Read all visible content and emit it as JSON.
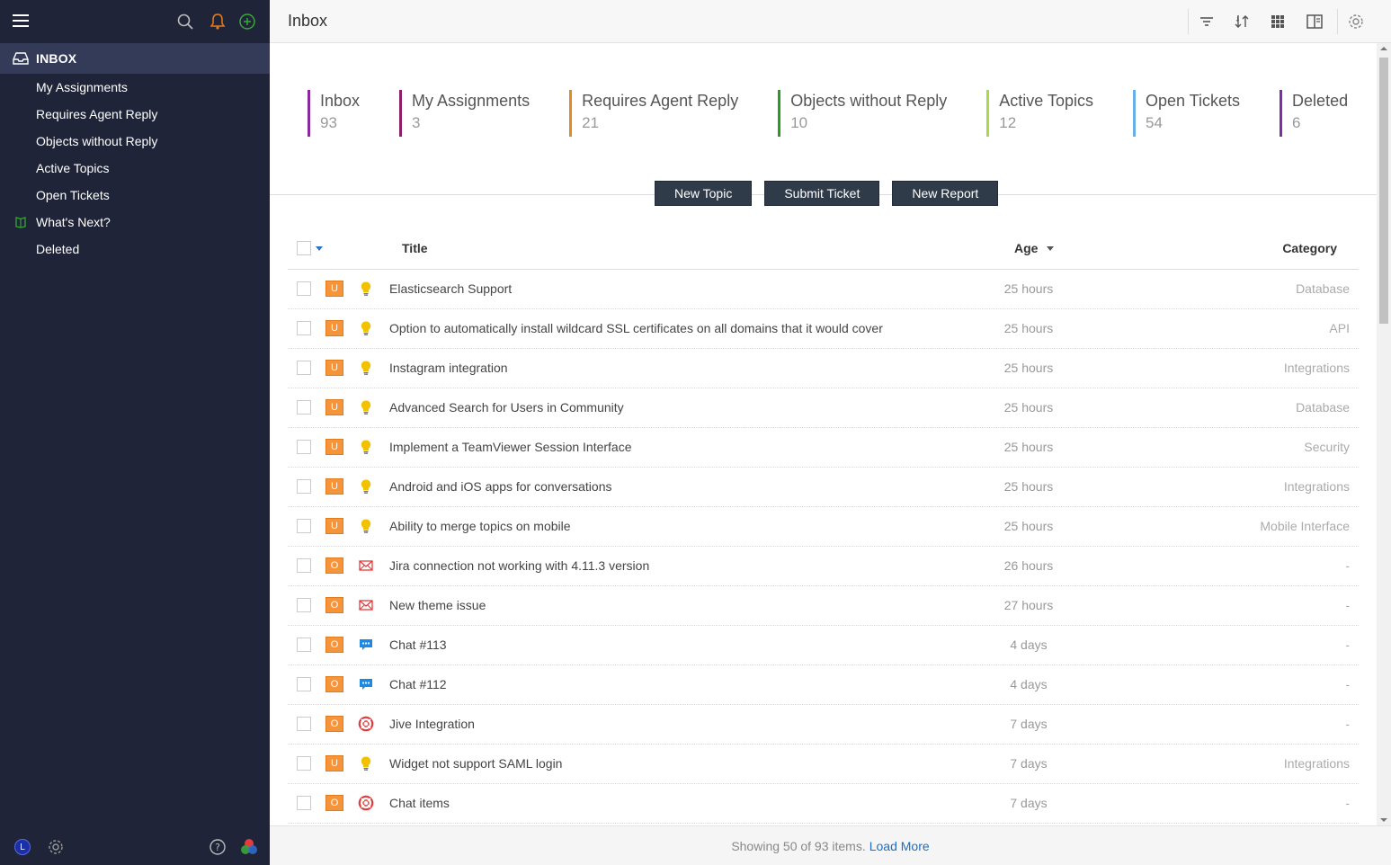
{
  "sidebar": {
    "inbox_label": "INBOX",
    "items": [
      {
        "label": "My Assignments"
      },
      {
        "label": "Requires Agent Reply"
      },
      {
        "label": "Objects without Reply"
      },
      {
        "label": "Active Topics"
      },
      {
        "label": "Open Tickets"
      },
      {
        "label": "What's Next?"
      },
      {
        "label": "Deleted"
      }
    ],
    "avatar_initial": "L"
  },
  "header": {
    "title": "Inbox"
  },
  "stats": [
    {
      "label": "Inbox",
      "count": "93",
      "color": "#8b2a9e"
    },
    {
      "label": "My Assignments",
      "count": "3",
      "color": "#8c1f6a"
    },
    {
      "label": "Requires Agent Reply",
      "count": "21",
      "color": "#e08a2c"
    },
    {
      "label": "Objects without Reply",
      "count": "10",
      "color": "#2e9a26"
    },
    {
      "label": "Active Topics",
      "count": "12",
      "color": "#a9d84a"
    },
    {
      "label": "Open Tickets",
      "count": "54",
      "color": "#6aaee8"
    },
    {
      "label": "Deleted",
      "count": "6",
      "color": "#7b2fa3"
    }
  ],
  "actions": {
    "new_topic": "New Topic",
    "submit_ticket": "Submit Ticket",
    "new_report": "New Report"
  },
  "table": {
    "columns": {
      "title": "Title",
      "age": "Age",
      "category": "Category"
    },
    "rows": [
      {
        "badge": "U",
        "icon": "lightbulb-icon",
        "title": "Elasticsearch Support",
        "age": "25 hours",
        "category": "Database"
      },
      {
        "badge": "U",
        "icon": "lightbulb-icon",
        "title": "Option to automatically install wildcard SSL certificates on all domains that it would cover",
        "age": "25 hours",
        "category": "API"
      },
      {
        "badge": "U",
        "icon": "lightbulb-icon",
        "title": "Instagram integration",
        "age": "25 hours",
        "category": "Integrations"
      },
      {
        "badge": "U",
        "icon": "lightbulb-icon",
        "title": "Advanced Search for Users in Community",
        "age": "25 hours",
        "category": "Database"
      },
      {
        "badge": "U",
        "icon": "lightbulb-icon",
        "title": "Implement a TeamViewer Session Interface",
        "age": "25 hours",
        "category": "Security"
      },
      {
        "badge": "U",
        "icon": "lightbulb-icon",
        "title": "Android and iOS apps for conversations",
        "age": "25 hours",
        "category": "Integrations"
      },
      {
        "badge": "U",
        "icon": "lightbulb-icon",
        "title": "Ability to merge topics on mobile",
        "age": "25 hours",
        "category": "Mobile Interface"
      },
      {
        "badge": "O",
        "icon": "envelope-icon",
        "title": "Jira connection not working with 4.11.3 version",
        "age": "26 hours",
        "category": "-"
      },
      {
        "badge": "O",
        "icon": "envelope-icon",
        "title": "New theme issue",
        "age": "27 hours",
        "category": "-"
      },
      {
        "badge": "O",
        "icon": "chat-icon",
        "title": "Chat #113",
        "age": "4 days",
        "category": "-"
      },
      {
        "badge": "O",
        "icon": "chat-icon",
        "title": "Chat #112",
        "age": "4 days",
        "category": "-"
      },
      {
        "badge": "O",
        "icon": "lifebuoy-icon",
        "title": "Jive Integration",
        "age": "7 days",
        "category": "-"
      },
      {
        "badge": "U",
        "icon": "lightbulb-icon",
        "title": "Widget not support SAML login",
        "age": "7 days",
        "category": "Integrations"
      },
      {
        "badge": "O",
        "icon": "lifebuoy-icon",
        "title": "Chat items",
        "age": "7 days",
        "category": "-"
      }
    ]
  },
  "footer": {
    "showing": "Showing 50 of 93 items.",
    "load_more": "Load More"
  }
}
